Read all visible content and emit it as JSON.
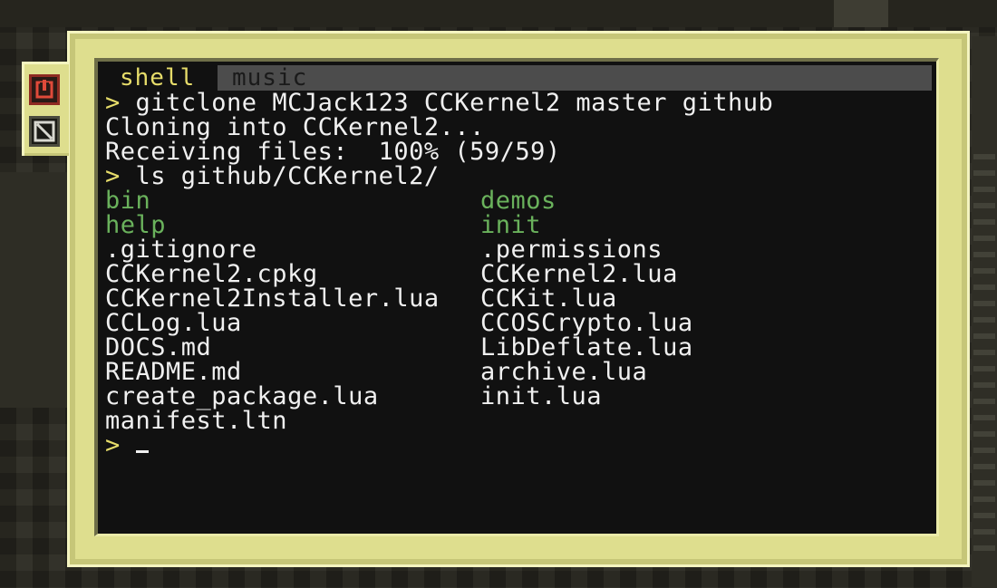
{
  "tabs": [
    {
      "label": "shell",
      "active": true
    },
    {
      "label": "music",
      "active": false
    }
  ],
  "side_buttons": [
    {
      "name": "power-icon",
      "color": "#e04a3a"
    },
    {
      "name": "no-entry-icon",
      "color": "#d8d8d0"
    }
  ],
  "terminal": {
    "prompt_symbol": ">",
    "lines": [
      {
        "prompt": "> ",
        "text": "gitclone MCJack123 CCKernel2 master github"
      },
      {
        "prompt": "",
        "text": "Cloning into CCKernel2..."
      },
      {
        "prompt": "",
        "text": "Receiving files:  100% (59/59)"
      },
      {
        "prompt": "> ",
        "text": "ls github/CCKernel2/"
      }
    ],
    "listing": [
      [
        "bin",
        "demos"
      ],
      [
        "help",
        "init"
      ],
      [
        ".gitignore",
        ".permissions"
      ],
      [
        "CCKernel2.cpkg",
        "CCKernel2.lua"
      ],
      [
        "CCKernel2Installer.lua",
        "CCKit.lua"
      ],
      [
        "CCLog.lua",
        "CCOSCrypto.lua"
      ],
      [
        "DOCS.md",
        "LibDeflate.lua"
      ],
      [
        "README.md",
        "archive.lua"
      ],
      [
        "create_package.lua",
        "init.lua"
      ],
      [
        "manifest.ltn",
        ""
      ]
    ],
    "directories": [
      "bin",
      "demos",
      "help",
      "init"
    ],
    "final_prompt": "> "
  },
  "colors": {
    "prompt": "#e6dc6a",
    "directory": "#6ab25c",
    "file": "#f0f0f0",
    "frame": "#dede8e",
    "screen": "#111111"
  }
}
